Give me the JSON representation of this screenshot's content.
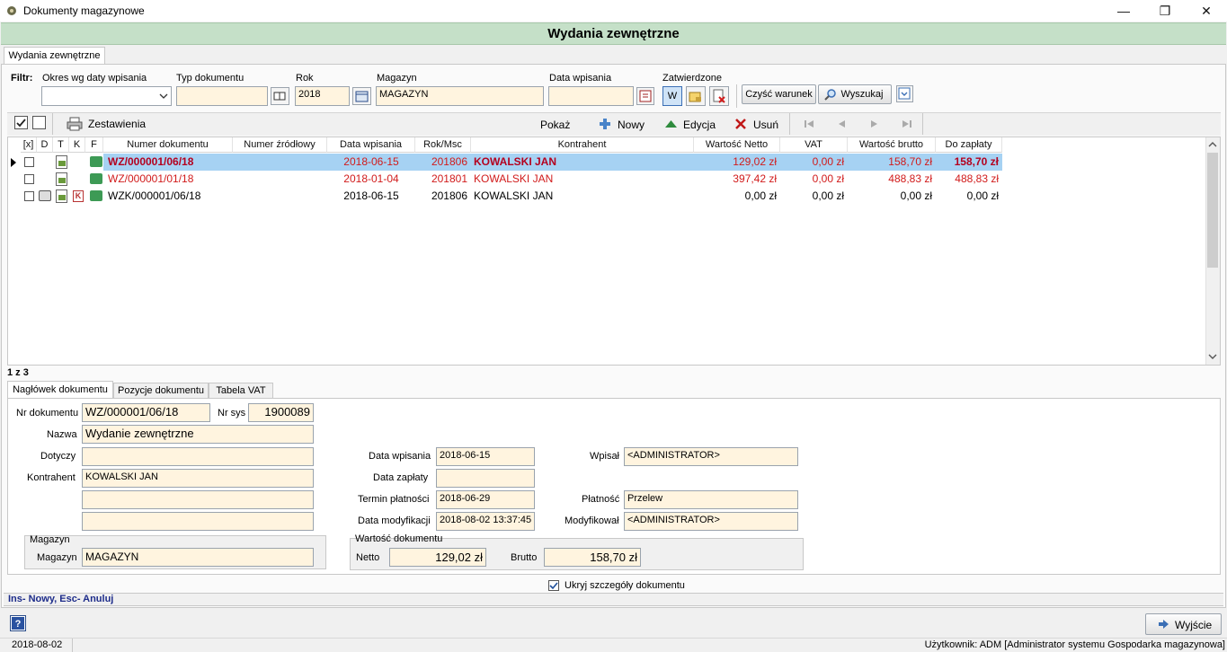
{
  "window": {
    "title": "Dokumenty magazynowe"
  },
  "header": {
    "title": "Wydania zewnętrzne"
  },
  "main_tab": "Wydania zewnętrzne",
  "filter": {
    "label": "Filtr:",
    "okres_label": "Okres wg daty wpisania",
    "okres_value": "",
    "typ_label": "Typ dokumentu",
    "typ_value": "",
    "rok_label": "Rok",
    "rok_value": "2018",
    "magazyn_label": "Magazyn",
    "magazyn_value": "MAGAZYN",
    "data_label": "Data wpisania",
    "data_value": "",
    "zatw_label": "Zatwierdzone",
    "zatw_w": "W",
    "clear_btn": "Czyść warunek",
    "search_btn": "Wyszukaj"
  },
  "toolbar": {
    "zestawienia": "Zestawienia",
    "pokaz": "Pokaż",
    "nowy": "Nowy",
    "edycja": "Edycja",
    "usun": "Usuń"
  },
  "grid": {
    "columns": [
      "[x]",
      "D",
      "T",
      "K",
      "F",
      "Numer dokumentu",
      "Numer źródłowy",
      "Data wpisania",
      "Rok/Msc",
      "Kontrahent",
      "Wartość Netto",
      "VAT",
      "Wartość brutto",
      "Do zapłaty"
    ],
    "rows": [
      {
        "numer": "WZ/000001/06/18",
        "zrodlowy": "",
        "data": "2018-06-15",
        "rokmsc": "201806",
        "kontrahent": "KOWALSKI JAN",
        "netto": "129,02 zł",
        "vat": "0,00 zł",
        "brutto": "158,70 zł",
        "zaplata": "158,70 zł"
      },
      {
        "numer": "WZ/000001/01/18",
        "zrodlowy": "",
        "data": "2018-01-04",
        "rokmsc": "201801",
        "kontrahent": "KOWALSKI JAN",
        "netto": "397,42 zł",
        "vat": "0,00 zł",
        "brutto": "488,83 zł",
        "zaplata": "488,83 zł"
      },
      {
        "numer": "WZK/000001/06/18",
        "zrodlowy": "",
        "data": "2018-06-15",
        "rokmsc": "201806",
        "kontrahent": "KOWALSKI JAN",
        "netto": "0,00 zł",
        "vat": "0,00 zł",
        "brutto": "0,00 zł",
        "zaplata": "0,00 zł"
      }
    ],
    "record_counter": "1 z 3"
  },
  "detail_tabs": [
    "Nagłówek dokumentu",
    "Pozycje dokumentu",
    "Tabela VAT"
  ],
  "detail": {
    "nr_dok_label": "Nr dokumentu",
    "nr_dok": "WZ/000001/06/18",
    "nr_sys_label": "Nr sys",
    "nr_sys": "1900089",
    "nazwa_label": "Nazwa",
    "nazwa": "Wydanie zewnętrzne",
    "dotyczy_label": "Dotyczy",
    "dotyczy": "",
    "kontrahent_label": "Kontrahent",
    "kontrahent": "KOWALSKI JAN",
    "kontrahent2": "",
    "kontrahent3": "",
    "data_wpis_label": "Data wpisania",
    "data_wpis": "2018-06-15",
    "data_zapl_label": "Data zapłaty",
    "data_zapl": "",
    "termin_label": "Termin płatności",
    "termin": "2018-06-29",
    "data_mod_label": "Data modyfikacji",
    "data_mod": "2018-08-02 13:37:45",
    "wpisal_label": "Wpisał",
    "wpisal": "<ADMINISTRATOR>",
    "platnosc_label": "Płatność",
    "platnosc": "Przelew",
    "modyfikowal_label": "Modyfikował",
    "modyfikowal": "<ADMINISTRATOR>",
    "magazyn_group": "Magazyn",
    "magazyn_label": "Magazyn",
    "magazyn": "MAGAZYN",
    "wartosc_group": "Wartość dokumentu",
    "netto_label": "Netto",
    "netto": "129,02 zł",
    "brutto_label": "Brutto",
    "brutto": "158,70 zł"
  },
  "hide_details": "Ukryj szczegóły dokumentu",
  "hint": "Ins- Nowy, Esc- Anuluj",
  "exit_btn": "Wyjście",
  "statusbar": {
    "date": "2018-08-02",
    "user": "Użytkownik: ADM [Administrator systemu Gospodarka magazynowa]"
  }
}
